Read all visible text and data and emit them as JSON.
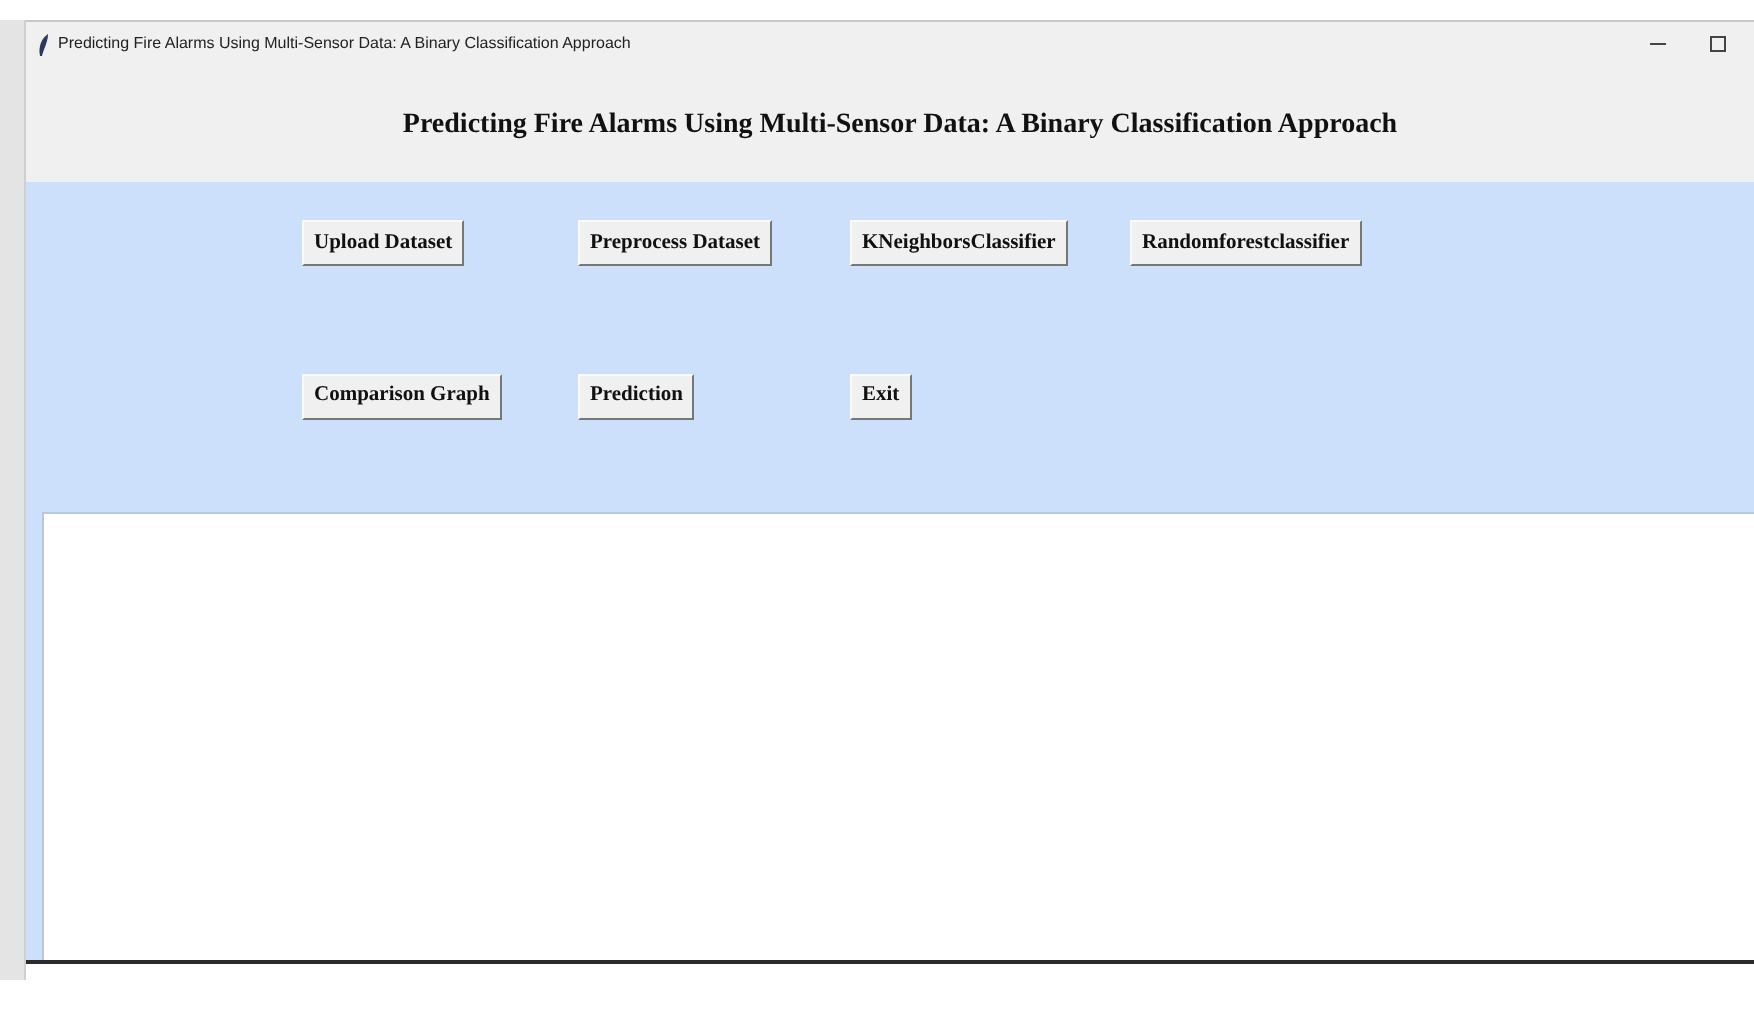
{
  "window": {
    "title": "Predicting Fire Alarms Using Multi-Sensor Data: A Binary Classification Approach"
  },
  "heading": "Predicting Fire Alarms Using Multi-Sensor Data: A Binary Classification Approach",
  "button_rows": [
    [
      "Upload Dataset",
      "Preprocess Dataset",
      "KNeighborsClassifier",
      "Randomforestclassifier"
    ],
    [
      "Comparison Graph",
      "Prediction",
      "Exit"
    ]
  ]
}
